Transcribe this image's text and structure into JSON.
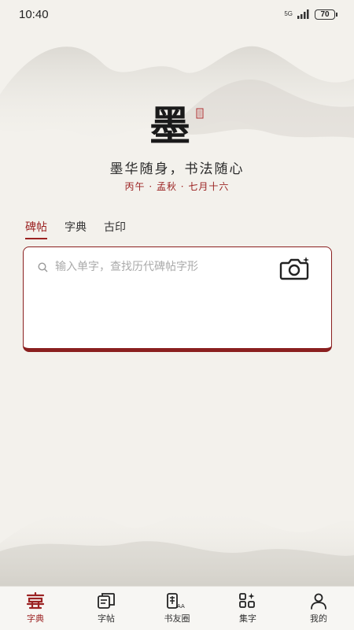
{
  "status": {
    "time": "10:40",
    "network": "5G",
    "battery": "70"
  },
  "brand": {
    "logo_char": "墨"
  },
  "slogan": "墨华随身，书法随心",
  "date": "丙午 · 孟秋 · 七月十六",
  "tabs": [
    {
      "label": "碑帖",
      "active": true
    },
    {
      "label": "字典",
      "active": false
    },
    {
      "label": "古印",
      "active": false
    }
  ],
  "search": {
    "placeholder": "输入单字，查找历代碑帖字形",
    "value": ""
  },
  "nav": [
    {
      "label": "字典",
      "icon": "dictionary-icon",
      "active": true
    },
    {
      "label": "字帖",
      "icon": "copybook-icon",
      "active": false
    },
    {
      "label": "书友圈",
      "icon": "community-icon",
      "active": false
    },
    {
      "label": "集字",
      "icon": "collect-chars-icon",
      "active": false
    },
    {
      "label": "我的",
      "icon": "profile-icon",
      "active": false
    }
  ],
  "colors": {
    "accent": "#9b2222",
    "background": "#f3f1ec"
  }
}
